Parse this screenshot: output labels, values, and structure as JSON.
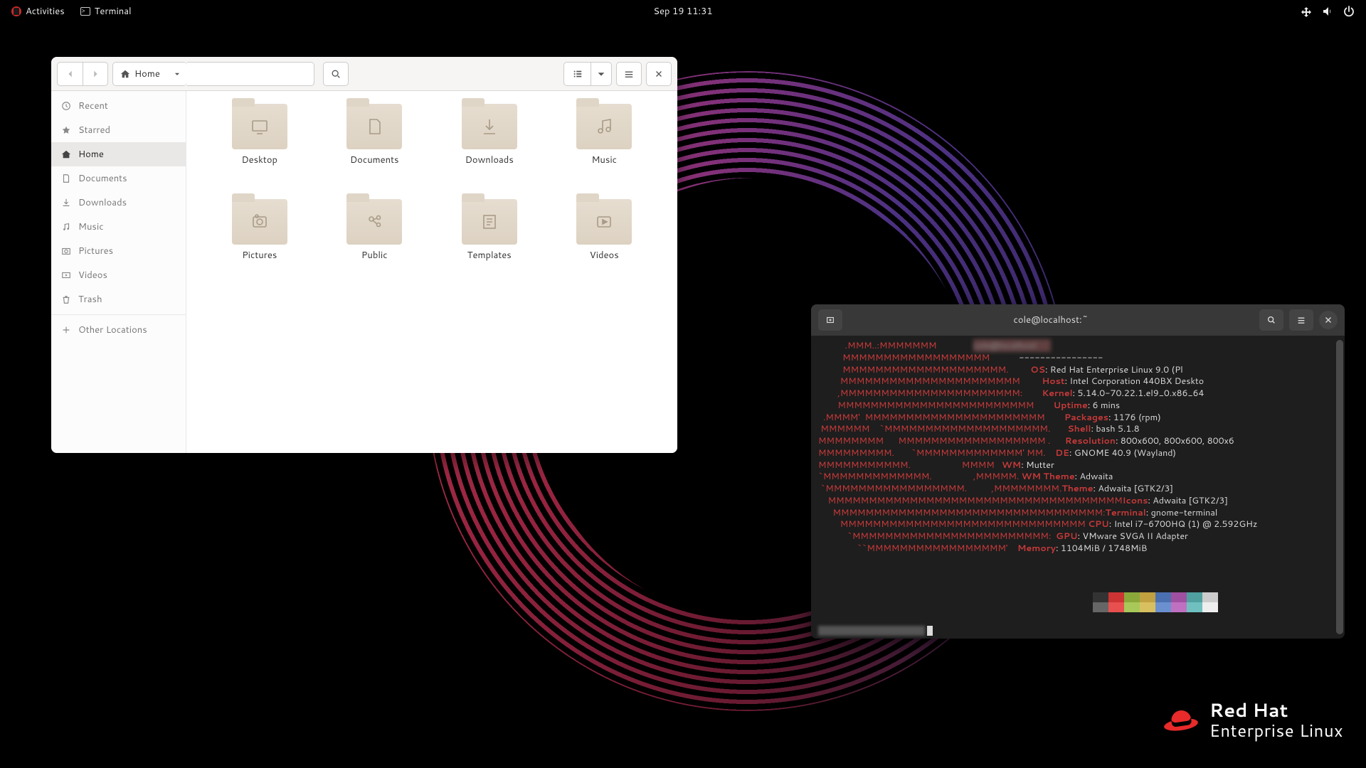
{
  "panel": {
    "activities": "Activities",
    "terminal_label": "Terminal",
    "datetime": "Sep 19  11:31"
  },
  "files": {
    "path_label": "Home",
    "sidebar": {
      "recent": "Recent",
      "starred": "Starred",
      "home": "Home",
      "documents": "Documents",
      "downloads": "Downloads",
      "music": "Music",
      "pictures": "Pictures",
      "videos": "Videos",
      "trash": "Trash",
      "other": "Other Locations"
    },
    "folders": [
      {
        "name": "Desktop"
      },
      {
        "name": "Documents"
      },
      {
        "name": "Downloads"
      },
      {
        "name": "Music"
      },
      {
        "name": "Pictures"
      },
      {
        "name": "Public"
      },
      {
        "name": "Templates"
      },
      {
        "name": "Videos"
      }
    ]
  },
  "terminal": {
    "title": "cole@localhost:~",
    "neofetch": {
      "sep": "----------------",
      "os": {
        "k": "OS",
        "v": ": Red Hat Enterprise Linux 9.0 (Pl"
      },
      "host": {
        "k": "Host",
        "v": ": Intel Corporation 440BX Deskto"
      },
      "kernel": {
        "k": "Kernel",
        "v": ": 5.14.0-70.22.1.el9_0.x86_64"
      },
      "uptime": {
        "k": "Uptime",
        "v": ": 6 mins"
      },
      "packages": {
        "k": "Packages",
        "v": ": 1176 (rpm)"
      },
      "shell": {
        "k": "Shell",
        "v": ": bash 5.1.8"
      },
      "resolution": {
        "k": "Resolution",
        "v": ": 800x600, 800x600, 800x6"
      },
      "de": {
        "k": "DE",
        "v": ": GNOME 40.9 (Wayland)"
      },
      "wm": {
        "k": "WM",
        "v": ": Mutter"
      },
      "wmtheme": {
        "k": "WM Theme",
        "v": ": Adwaita"
      },
      "theme": {
        "k": "Theme",
        "v": ": Adwaita [GTK2/3]"
      },
      "icons": {
        "k": "Icons",
        "v": ": Adwaita [GTK2/3]"
      },
      "terminal": {
        "k": "Terminal",
        "v": ": gnome-terminal"
      },
      "cpu": {
        "k": "CPU",
        "v": ": Intel i7-6700HQ (1) @ 2.592GHz"
      },
      "gpu": {
        "k": "GPU",
        "v": ": VMware SVGA II Adapter"
      },
      "memory": {
        "k": "Memory",
        "v": ": 1104MiB / 1748MiB"
      }
    },
    "colors": [
      "#333",
      "#cc3333",
      "#8aa83a",
      "#c0a040",
      "#4a70b0",
      "#a050a0",
      "#50a0a0",
      "#ccc",
      "#666",
      "#e85050",
      "#a8c85a",
      "#d8c060",
      "#6a90d0",
      "#c070c0",
      "#70c0c0",
      "#eee"
    ],
    "ascii": "           .MMM..:MMMMMMM\n          MMMMMMMMMMMMMMMMMM\n          MMMMMMMMMMMMMMMMMMMM.\n         MMMMMMMMMMMMMMMMMMMMMM\n        ,MMMMMMMMMMMMMMMMMMMMMM:\n        MMMMMMMMMMMMMMMMMMMMMMMM\n  .MMMM'  MMMMMMMMMMMMMMMMMMMMMM\n MMMMMM    `MMMMMMMMMMMMMMMMMMMM.\nMMMMMMMM      MMMMMMMMMMMMMMMMMM .\nMMMMMMMMM.       `MMMMMMMMMMMMM' MM.\nMMMMMMMMMMM.                     MMMM\n`MMMMMMMMMMMMM.                 ,MMMMM.\n `MMMMMMMMMMMMMMMMM.          ,MMMMMMMM.\n    MMMMMMMMMMMMMMMMMMMMMMMMMMMMMMMMMMMM\n      MMMMMMMMMMMMMMMMMMMMMMMMMMMMMMMMM:\n         MMMMMMMMMMMMMMMMMMMMMMMMMMMMMM\n            `MMMMMMMMMMMMMMMMMMMMMMMM:\n                ``MMMMMMMMMMMMMMMMM'"
  },
  "logo": {
    "l1": "Red Hat",
    "l2": "Enterprise Linux"
  }
}
